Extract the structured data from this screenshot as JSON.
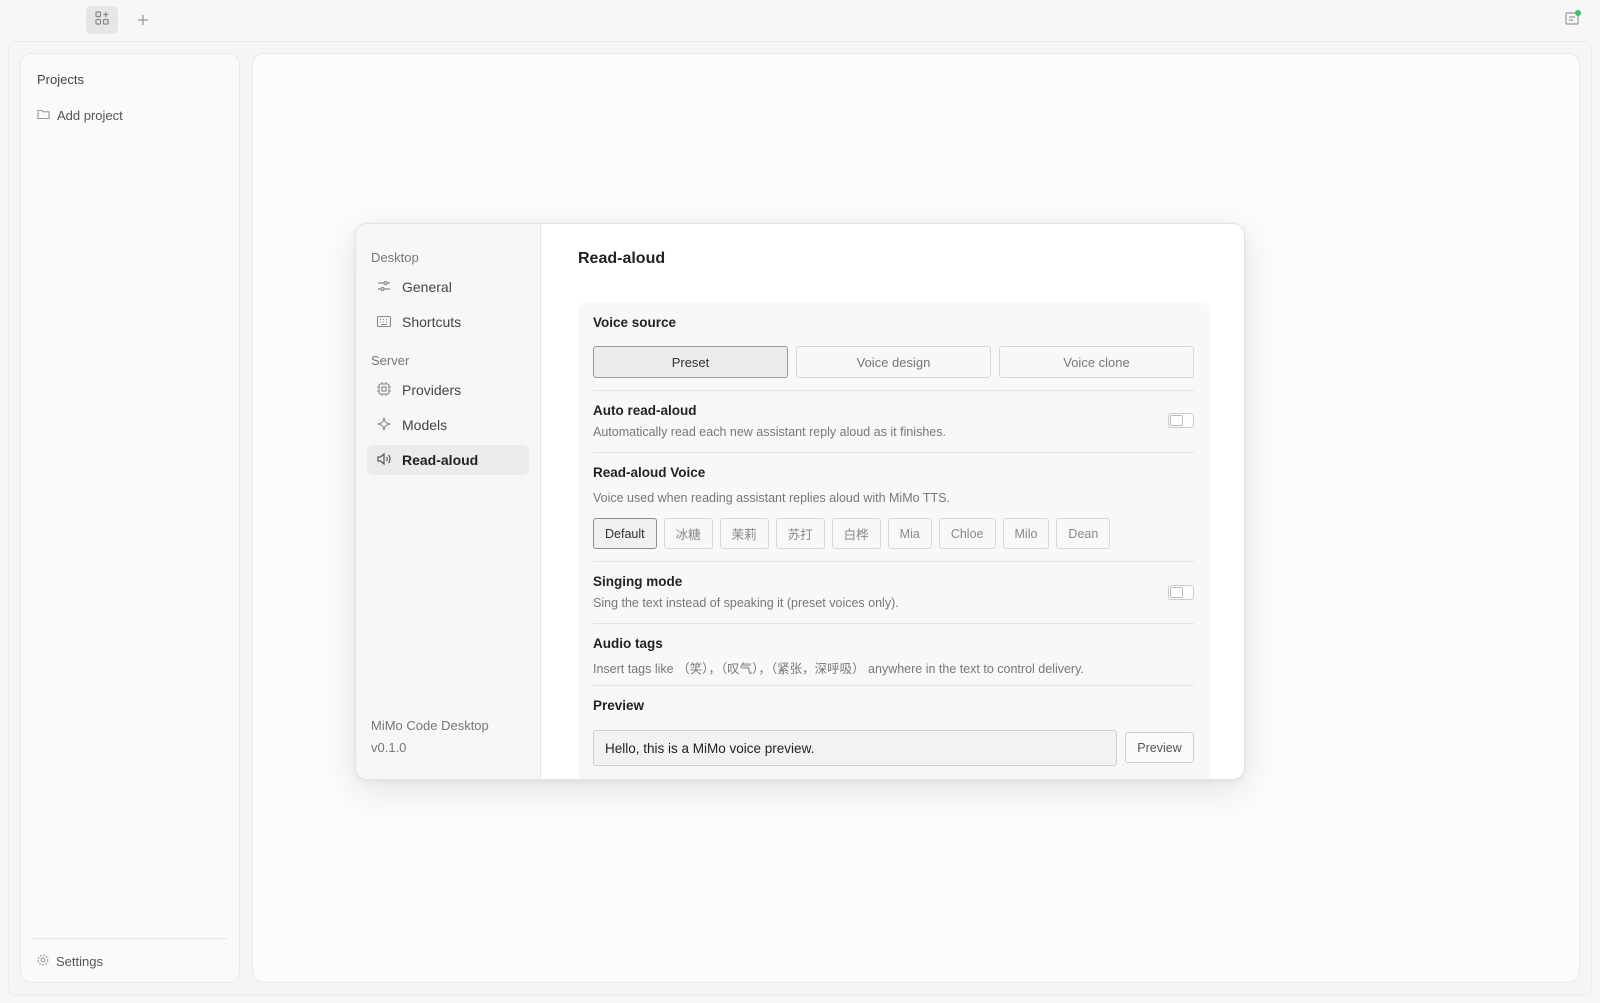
{
  "sidebar": {
    "title": "Projects",
    "add_project": "Add project",
    "settings": "Settings"
  },
  "dialog": {
    "nav": {
      "groups": [
        {
          "label": "Desktop",
          "items": [
            {
              "label": "General",
              "icon": "sliders-icon"
            },
            {
              "label": "Shortcuts",
              "icon": "keyboard-icon"
            }
          ]
        },
        {
          "label": "Server",
          "items": [
            {
              "label": "Providers",
              "icon": "chip-icon"
            },
            {
              "label": "Models",
              "icon": "sparkle-icon"
            },
            {
              "label": "Read-aloud",
              "icon": "speaker-icon",
              "active": true
            }
          ]
        }
      ],
      "app_name": "MiMo Code Desktop",
      "version": "v0.1.0"
    },
    "title": "Read-aloud",
    "voice_source": {
      "title": "Voice source",
      "options": [
        "Preset",
        "Voice design",
        "Voice clone"
      ],
      "selected": "Preset"
    },
    "auto_read": {
      "title": "Auto read-aloud",
      "desc": "Automatically read each new assistant reply aloud as it finishes.",
      "enabled": false
    },
    "voice": {
      "title": "Read-aloud Voice",
      "desc": "Voice used when reading assistant replies aloud with MiMo TTS.",
      "options": [
        "Default",
        "冰糖",
        "茉莉",
        "苏打",
        "白桦",
        "Mia",
        "Chloe",
        "Milo",
        "Dean"
      ],
      "selected": "Default"
    },
    "singing": {
      "title": "Singing mode",
      "desc": "Sing the text instead of speaking it (preset voices only).",
      "enabled": false
    },
    "audio_tags": {
      "title": "Audio tags",
      "desc": "Insert tags like （笑），（叹气），（紧张，深呼吸） anywhere in the text to control delivery."
    },
    "preview": {
      "title": "Preview",
      "value": "Hello, this is a MiMo voice preview.",
      "button": "Preview"
    }
  }
}
